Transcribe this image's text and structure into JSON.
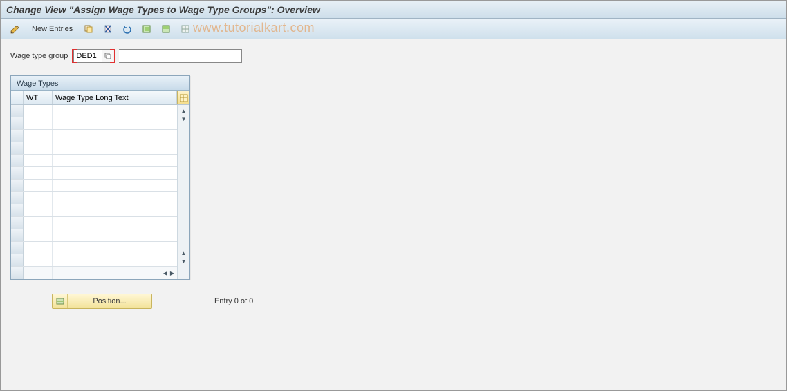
{
  "title": "Change View \"Assign Wage Types to Wage Type Groups\": Overview",
  "toolbar": {
    "new_entries_label": "New Entries"
  },
  "watermark": "www.tutorialkart.com",
  "field": {
    "label": "Wage type group",
    "value": "DED1"
  },
  "grid": {
    "title": "Wage Types",
    "columns": {
      "wt": "WT",
      "text": "Wage Type Long Text"
    },
    "rows": [
      "",
      "",
      "",
      "",
      "",
      "",
      "",
      "",
      "",
      "",
      "",
      "",
      ""
    ]
  },
  "bottom": {
    "position_label": "Position...",
    "entry_text": "Entry 0 of 0"
  }
}
